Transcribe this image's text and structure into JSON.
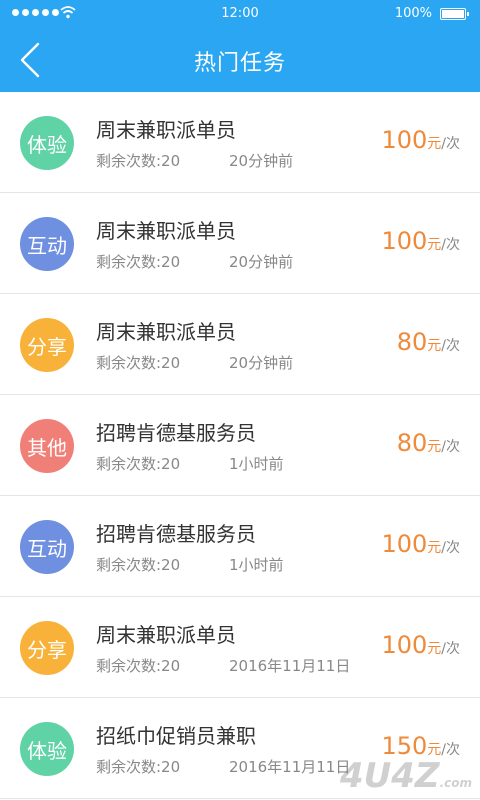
{
  "status_bar": {
    "time": "12:00",
    "battery": "100%"
  },
  "header": {
    "title": "热门任务",
    "back_icon": "chevron-left-icon"
  },
  "colors": {
    "header_bg": "#2ba6f3",
    "price": "#ef8a3a",
    "badge_experience": "#5fd3a5",
    "badge_interact": "#6f8fe0",
    "badge_share": "#f8b23a",
    "badge_other": "#f07f78"
  },
  "tasks": [
    {
      "badge": "体验",
      "name": "周末兼职派单员",
      "remain": "剩余次数:20",
      "time": "20分钟前",
      "amount": "100",
      "unit": "元",
      "per": "/次",
      "color": "#5fd3a5"
    },
    {
      "badge": "互动",
      "name": "周末兼职派单员",
      "remain": "剩余次数:20",
      "time": "20分钟前",
      "amount": "100",
      "unit": "元",
      "per": "/次",
      "color": "#6f8fe0"
    },
    {
      "badge": "分享",
      "name": "周末兼职派单员",
      "remain": "剩余次数:20",
      "time": "20分钟前",
      "amount": "80",
      "unit": "元",
      "per": "/次",
      "color": "#f8b23a"
    },
    {
      "badge": "其他",
      "name": "招聘肯德基服务员",
      "remain": "剩余次数:20",
      "time": "1小时前",
      "amount": "80",
      "unit": "元",
      "per": "/次",
      "color": "#f07f78"
    },
    {
      "badge": "互动",
      "name": "招聘肯德基服务员",
      "remain": "剩余次数:20",
      "time": "1小时前",
      "amount": "100",
      "unit": "元",
      "per": "/次",
      "color": "#6f8fe0"
    },
    {
      "badge": "分享",
      "name": "周末兼职派单员",
      "remain": "剩余次数:20",
      "time": "2016年11月11日",
      "amount": "100",
      "unit": "元",
      "per": "/次",
      "color": "#f8b23a"
    },
    {
      "badge": "体验",
      "name": "招纸巾促销员兼职",
      "remain": "剩余次数:20",
      "time": "2016年11月11日",
      "amount": "150",
      "unit": "元",
      "per": "/次",
      "color": "#5fd3a5"
    }
  ],
  "watermark": "4U4Z"
}
